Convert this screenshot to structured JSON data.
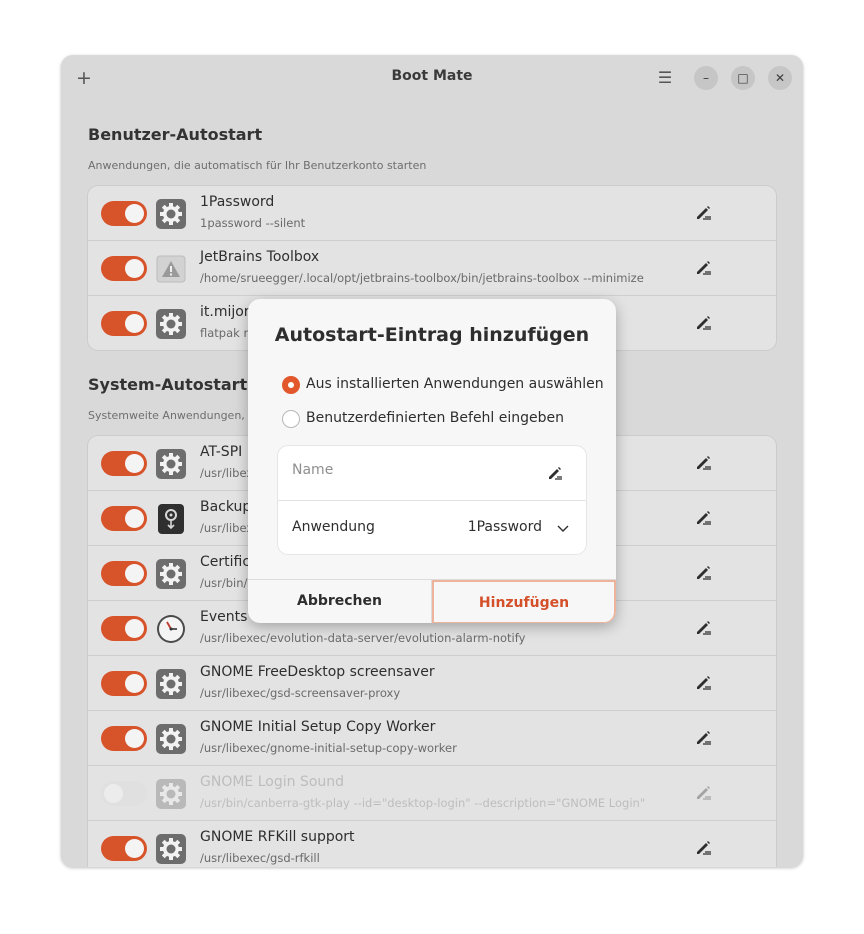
{
  "window": {
    "title": "Boot Mate",
    "add_icon": "plus-icon",
    "menu_icon": "hamburger-menu-icon",
    "minimize_icon": "minimize-icon",
    "maximize_icon": "maximize-icon",
    "close_icon": "close-icon"
  },
  "user_section": {
    "title": "Benutzer-Autostart",
    "subtitle": "Anwendungen, die automatisch für Ihr Benutzerkonto starten",
    "items": [
      {
        "title": "1Password",
        "command": "1password --silent",
        "enabled": true,
        "icon": "gear-icon"
      },
      {
        "title": "JetBrains Toolbox",
        "command": "/home/srueegger/.local/opt/jetbrains-toolbox/bin/jetbrains-toolbox --minimize",
        "enabled": true,
        "icon": "warning-icon"
      },
      {
        "title": "it.mijor",
        "command": "flatpak ru",
        "enabled": true,
        "icon": "gear-icon"
      }
    ]
  },
  "system_section": {
    "title": "System-Autostart",
    "subtitle": "Systemweite Anwendungen,",
    "items": [
      {
        "title": "AT-SPI D",
        "command": "/usr/libex",
        "enabled": true,
        "icon": "gear-icon"
      },
      {
        "title": "Backup",
        "command": "/usr/libex",
        "enabled": true,
        "icon": "backup-safe-icon"
      },
      {
        "title": "Certific",
        "command": "/usr/bin/",
        "enabled": true,
        "icon": "gear-icon"
      },
      {
        "title": "Events and Tasks Reminders",
        "command": "/usr/libexec/evolution-data-server/evolution-alarm-notify",
        "enabled": true,
        "icon": "clock-icon"
      },
      {
        "title": "GNOME FreeDesktop screensaver",
        "command": "/usr/libexec/gsd-screensaver-proxy",
        "enabled": true,
        "icon": "gear-icon"
      },
      {
        "title": "GNOME Initial Setup Copy Worker",
        "command": "/usr/libexec/gnome-initial-setup-copy-worker",
        "enabled": true,
        "icon": "gear-icon"
      },
      {
        "title": "GNOME Login Sound",
        "command": "/usr/bin/canberra-gtk-play --id=\"desktop-login\" --description=\"GNOME Login\"",
        "enabled": false,
        "icon": "gear-icon"
      },
      {
        "title": "GNOME RFKill support",
        "command": "/usr/libexec/gsd-rfkill",
        "enabled": true,
        "icon": "gear-icon"
      }
    ]
  },
  "dialog": {
    "title": "Autostart-Eintrag hinzufügen",
    "option_installed": "Aus installierten Anwendungen auswählen",
    "option_custom": "Benutzerdefinierten Befehl eingeben",
    "selected_option": "installed",
    "name_placeholder": "Name",
    "name_value": "",
    "application_label": "Anwendung",
    "application_value": "1Password",
    "cancel_label": "Abbrechen",
    "add_label": "Hinzufügen"
  },
  "colors": {
    "accent": "#e2572b",
    "window_bg": "#d9d9d9",
    "list_bg": "#e3e3e3",
    "dialog_bg": "#f7f7f7"
  }
}
